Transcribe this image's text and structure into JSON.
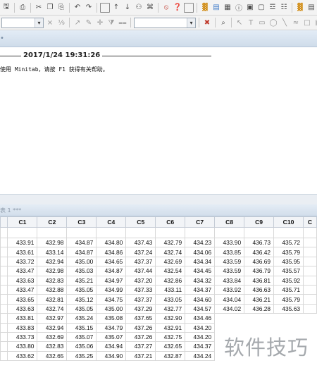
{
  "session": {
    "timestamp": "2017/1/24 19:31:26",
    "help_hint": "使用 Minitab，请按 F1 获得有关帮助。"
  },
  "worksheet": {
    "title_fragment": "表 1 ***",
    "columns": [
      "C1",
      "C2",
      "C3",
      "C4",
      "C5",
      "C6",
      "C7",
      "C8",
      "C9",
      "C10",
      "C"
    ],
    "rows": [
      [
        "433.91",
        "432.98",
        "434.87",
        "434.80",
        "437.43",
        "432.79",
        "434.23",
        "433.90",
        "436.73",
        "435.72"
      ],
      [
        "433.61",
        "433.14",
        "434.87",
        "434.86",
        "437.24",
        "432.74",
        "434.06",
        "433.85",
        "436.42",
        "435.79"
      ],
      [
        "433.72",
        "432.94",
        "435.00",
        "434.65",
        "437.37",
        "432.69",
        "434.34",
        "433.59",
        "436.69",
        "435.95"
      ],
      [
        "433.47",
        "432.98",
        "435.03",
        "434.87",
        "437.44",
        "432.54",
        "434.45",
        "433.59",
        "436.79",
        "435.57"
      ],
      [
        "433.63",
        "432.83",
        "435.21",
        "434.97",
        "437.20",
        "432.86",
        "434.32",
        "433.84",
        "436.81",
        "435.92"
      ],
      [
        "433.47",
        "432.88",
        "435.05",
        "434.99",
        "437.33",
        "433.11",
        "434.37",
        "433.92",
        "436.63",
        "435.71"
      ],
      [
        "433.65",
        "432.81",
        "435.12",
        "434.75",
        "437.37",
        "433.05",
        "434.60",
        "434.04",
        "436.21",
        "435.79"
      ],
      [
        "433.63",
        "432.74",
        "435.05",
        "435.00",
        "437.29",
        "432.77",
        "434.57",
        "434.02",
        "436.28",
        "435.63"
      ],
      [
        "433.81",
        "432.97",
        "435.24",
        "435.08",
        "437.65",
        "432.90",
        "434.46",
        "",
        "",
        ""
      ],
      [
        "433.83",
        "432.94",
        "435.15",
        "434.79",
        "437.26",
        "432.91",
        "434.20",
        "",
        "",
        ""
      ],
      [
        "433.73",
        "432.69",
        "435.07",
        "435.07",
        "437.26",
        "432.75",
        "434.20",
        "",
        "",
        ""
      ],
      [
        "433.80",
        "432.83",
        "435.06",
        "434.94",
        "437.27",
        "432.65",
        "434.37",
        "",
        "",
        ""
      ],
      [
        "433.62",
        "432.65",
        "435.25",
        "434.90",
        "437.21",
        "432.87",
        "434.24",
        "",
        "",
        ""
      ]
    ]
  },
  "watermark": "软件技巧",
  "icons": [
    "save-icon",
    "print-icon",
    "cut-icon",
    "copy-icon",
    "paste-icon",
    "undo-icon",
    "redo-icon",
    "find-icon",
    "stop-icon",
    "help-icon",
    "graph-icon",
    "function-icon"
  ]
}
